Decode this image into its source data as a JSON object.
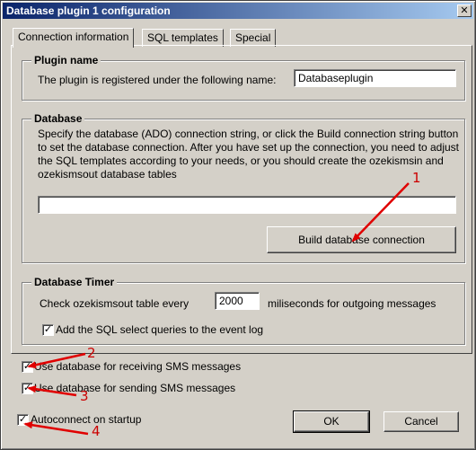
{
  "window": {
    "title": "Database plugin 1 configuration",
    "close_glyph": "✕"
  },
  "tabs": [
    {
      "label": "Connection information",
      "selected": true
    },
    {
      "label": "SQL templates",
      "selected": false
    },
    {
      "label": "Special",
      "selected": false
    }
  ],
  "plugin_name_group": {
    "title": "Plugin name",
    "label": "The plugin is registered under the following name:",
    "value": "Databaseplugin"
  },
  "database_group": {
    "title": "Database",
    "description": "Specify the database (ADO) connection string, or click the Build connection string button to set the database connection. After you have set up the connection, you need to adjust the SQL templates according to your needs, or you should create the ozekismsin and ozekismsout database tables",
    "connection_string": "",
    "build_button": "Build database connection"
  },
  "timer_group": {
    "title": "Database Timer",
    "check_label": "Check ozekismsout table every",
    "interval_value": "2000",
    "interval_suffix": "miliseconds for outgoing messages",
    "log_checkbox_label": "Add the SQL select queries to the event log",
    "log_checked": true
  },
  "options": {
    "receiving_label": "Use database for receiving SMS messages",
    "receiving_checked": true,
    "sending_label": "Use database for sending SMS messages",
    "sending_checked": true,
    "autoconnect_label": "Autoconnect on startup",
    "autoconnect_checked": true
  },
  "footer": {
    "ok_label": "OK",
    "cancel_label": "Cancel"
  },
  "annotations": {
    "marker_1": "1",
    "marker_2": "2",
    "marker_3": "3",
    "marker_4": "4",
    "color": "#cc0000"
  },
  "check_glyph": "✓",
  "colors": {
    "titlebar_start": "#0a246a",
    "titlebar_end": "#a6caf0",
    "window_bg": "#d4d0c8"
  }
}
